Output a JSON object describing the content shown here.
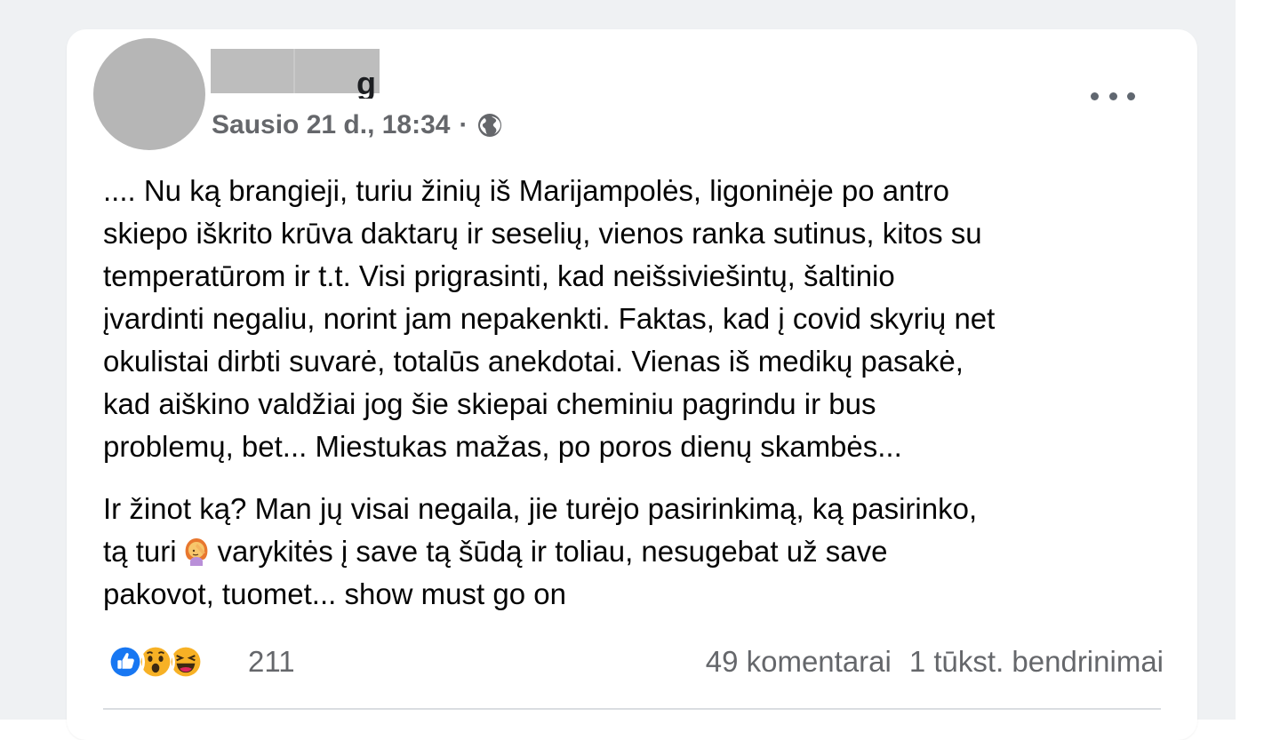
{
  "post": {
    "author_name": "g",
    "timestamp": "Sausio 21 d., 18:34",
    "separator": "·",
    "privacy_icon": "globe-icon",
    "body_lines_para1": [
      ".... Nu ką brangieji, turiu žinių iš Marijampolės, ligoninėje po antro",
      "skiepo iškrito krūva daktarų ir seselių, vienos ranka sutinus, kitos su",
      "temperatūrom ir t.t. Visi prigrasinti, kad neišsiviešintų, šaltinio",
      "įvardinti negaliu, norint jam nepakenkti. Faktas, kad į covid skyrių net",
      "okulistai dirbti suvarė, totalūs anekdotai. Vienas iš medikų pasakė,",
      "kad aiškino valdžiai jog šie skiepai cheminiu pagrindu ir bus",
      "problemų, bet... Miestukas mažas, po poros dienų skambės..."
    ],
    "para2_line1": "Ir žinot ką? Man jų visai negaila, jie turėjo pasirinkimą, ką pasirinko,",
    "para2_line2_before_emoji": "tą turi",
    "para2_emoji": "woman-facepalming-emoji",
    "para2_line2_after_emoji": "varykitės į save tą šūdą ir toliau, nesugebat už save",
    "para2_line3": "pakovot, tuomet... show must go on"
  },
  "reactions": {
    "icons": [
      "like-icon",
      "wow-icon",
      "haha-icon"
    ],
    "count": "211",
    "comments_label": "49 komentarai",
    "shares_label": "1 tūkst. bendrinimai"
  },
  "colors": {
    "backdrop": "#eff1f3",
    "card": "#ffffff",
    "secondary_text": "#65676b",
    "primary_text": "#050505",
    "like_blue": "#1877f2",
    "emoji_yellow": "#f7b125",
    "avatar_gray": "#b6b6b6",
    "redaction_gray": "#bdbdbd"
  }
}
